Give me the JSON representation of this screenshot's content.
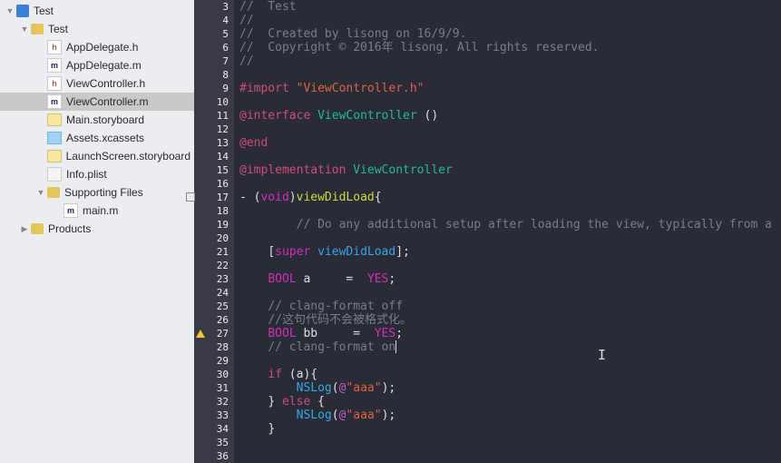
{
  "sidebar": {
    "root": {
      "label": "Test",
      "children": [
        {
          "label": "Test",
          "expanded": true,
          "children": [
            {
              "label": "AppDelegate.h",
              "type": "h"
            },
            {
              "label": "AppDelegate.m",
              "type": "m"
            },
            {
              "label": "ViewController.h",
              "type": "h"
            },
            {
              "label": "ViewController.m",
              "type": "m",
              "selected": true
            },
            {
              "label": "Main.storyboard",
              "type": "storyboard"
            },
            {
              "label": "Assets.xcassets",
              "type": "xcassets"
            },
            {
              "label": "LaunchScreen.storyboard",
              "type": "storyboard"
            },
            {
              "label": "Info.plist",
              "type": "plist"
            },
            {
              "label": "Supporting Files",
              "expanded": true,
              "children": [
                {
                  "label": "main.m",
                  "type": "m"
                }
              ]
            }
          ]
        },
        {
          "label": "Products",
          "expanded": false
        }
      ]
    }
  },
  "file": "ViewController.m",
  "gutter_start": 3,
  "gutter_end": 36,
  "warning_line": 27,
  "fold_line": 17,
  "cursor_line": 28,
  "code_lines": {
    "3": {
      "raw": "//  Test",
      "cls": "cmt"
    },
    "4": {
      "raw": "//",
      "cls": "cmt"
    },
    "5": {
      "raw": "//  Created by lisong on 16/9/9.",
      "cls": "cmt"
    },
    "6": {
      "raw": "//  Copyright © 2016年 lisong. All rights reserved.",
      "cls": "cmt"
    },
    "7": {
      "raw": "//",
      "cls": "cmt"
    },
    "8": {
      "raw": ""
    },
    "9": {
      "html": "<span class='kw-import'>#import</span> <span class='str'>\"ViewController.h\"</span>"
    },
    "10": {
      "raw": ""
    },
    "11": {
      "html": "<span class='kw-at'>@interface</span> <span class='type'>ViewController</span> <span class='punc'>()</span>"
    },
    "12": {
      "raw": ""
    },
    "13": {
      "html": "<span class='kw-at'>@end</span>"
    },
    "14": {
      "raw": ""
    },
    "15": {
      "html": "<span class='kw-at'>@implementation</span> <span class='type'>ViewController</span>"
    },
    "16": {
      "raw": ""
    },
    "17": {
      "html": "<span class='punc'>- (</span><span class='kw-type'>void</span><span class='punc'>)</span><span class='fn'>viewDidLoad</span><span class='punc'>{</span>"
    },
    "18": {
      "raw": ""
    },
    "19": {
      "html": "        <span class='cmt'>// Do any additional setup after loading the view, typically from a</span>"
    },
    "20": {
      "raw": ""
    },
    "21": {
      "html": "    <span class='punc'>[</span><span class='kw-sup'>super</span> <span class='call'>viewDidLoad</span><span class='punc'>];</span>"
    },
    "22": {
      "raw": ""
    },
    "23": {
      "html": "    <span class='kw-type'>BOOL</span> <span class='var'>a</span>     =  <span class='kw-val'>YES</span><span class='punc'>;</span>"
    },
    "24": {
      "raw": ""
    },
    "25": {
      "html": "    <span class='cmt'>// clang-format off</span>"
    },
    "26": {
      "html": "    <span class='cmt'>//这句代码不会被格式化。</span>"
    },
    "27": {
      "html": "    <span class='kw-type'>BOOL</span> <span class='var'>bb</span>     =  <span class='kw-val'>YES</span><span class='punc'>;</span>"
    },
    "28": {
      "html": "    <span class='cmt'>// clang-format on</span><span class='cursor'></span>"
    },
    "29": {
      "raw": ""
    },
    "30": {
      "html": "    <span class='kw-if'>if</span> <span class='punc'>(a){</span>"
    },
    "31": {
      "html": "        <span class='call'>NSLog</span><span class='punc'>(</span><span class='atlit'>@</span><span class='str'>\"aaa\"</span><span class='punc'>);</span>"
    },
    "32": {
      "html": "    <span class='punc'>}</span> <span class='kw-if'>else</span> <span class='punc'>{</span>"
    },
    "33": {
      "html": "        <span class='call'>NSLog</span><span class='punc'>(</span><span class='atlit'>@</span><span class='str'>\"aaa\"</span><span class='punc'>);</span>"
    },
    "34": {
      "html": "    <span class='punc'>}</span>"
    },
    "35": {
      "raw": ""
    },
    "36": {
      "raw": ""
    }
  }
}
